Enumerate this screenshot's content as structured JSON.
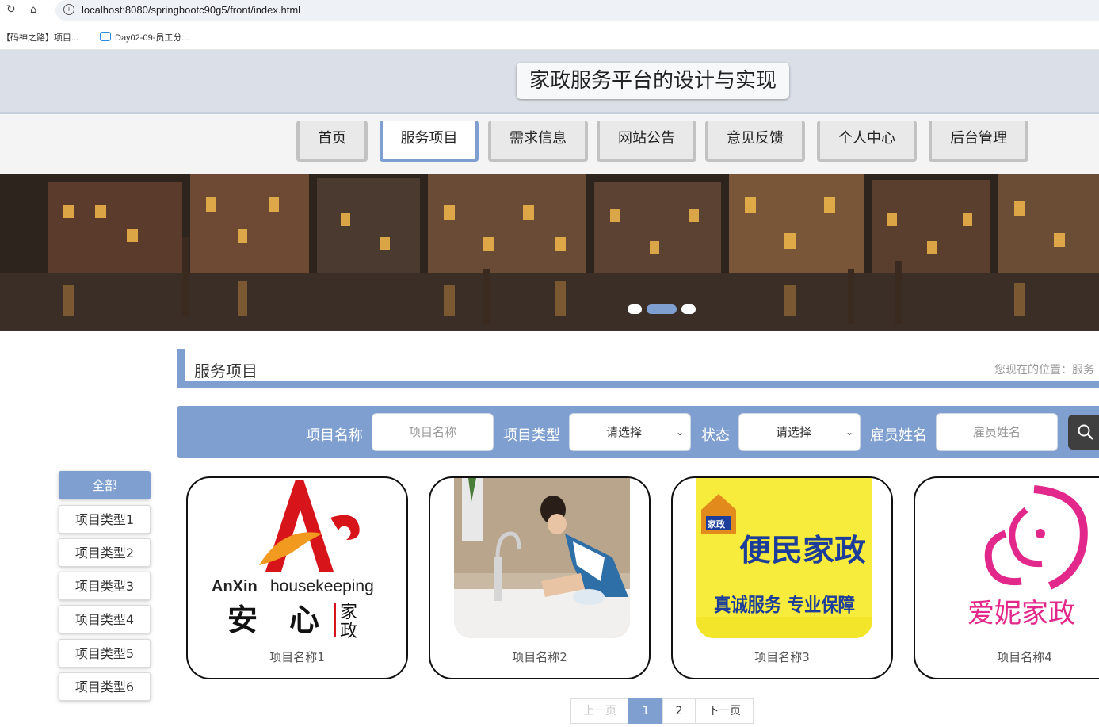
{
  "browser": {
    "url": "localhost:8080/springbootc90g5/front/index.html",
    "bookmarks": [
      "【码神之路】项目...",
      "Day02-09-员工分..."
    ]
  },
  "header": {
    "site_title": "家政服务平台的设计与实现"
  },
  "nav": {
    "items": [
      "首页",
      "服务项目",
      "需求信息",
      "网站公告",
      "意见反馈",
      "个人中心",
      "后台管理"
    ],
    "active_index": 1
  },
  "carousel": {
    "slide_count": 3,
    "active_index": 1
  },
  "section": {
    "title": "服务项目",
    "breadcrumb": "您现在的位置：服务"
  },
  "search": {
    "name_label": "项目名称",
    "name_placeholder": "项目名称",
    "type_label": "项目类型",
    "type_value": "请选择",
    "status_label": "状态",
    "status_value": "请选择",
    "employee_label": "雇员姓名",
    "employee_placeholder": "雇员姓名"
  },
  "categories": {
    "items": [
      "全部",
      "项目类型1",
      "项目类型2",
      "项目类型3",
      "项目类型4",
      "项目类型5",
      "项目类型6"
    ],
    "active_index": 0
  },
  "cards": [
    {
      "name": "项目名称1",
      "logo_en_a": "AnXin",
      "logo_en_b": "housekeeping",
      "logo_cn_a": "安",
      "logo_cn_b": "心",
      "logo_cn_c": "家",
      "logo_cn_d": "政"
    },
    {
      "name": "项目名称2"
    },
    {
      "name": "项目名称3",
      "logo_main": "便民家政",
      "logo_slogan": "真诚服务  专业保障",
      "logo_badge": "家政"
    },
    {
      "name": "项目名称4",
      "logo_text": "爱妮家政"
    }
  ],
  "pagination": {
    "prev": "上一页",
    "pages": [
      "1",
      "2"
    ],
    "next": "下一页",
    "current": "1"
  },
  "colors": {
    "accent": "#7e9fcf",
    "header_bg": "#dbe0e8",
    "search_btn": "#3f3f3f"
  }
}
